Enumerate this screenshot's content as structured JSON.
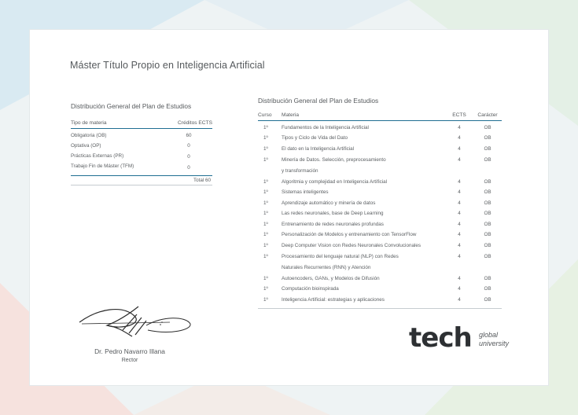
{
  "title": "Máster Título Propio en Inteligencia Artificial",
  "left_table": {
    "heading": "Distribución General del Plan de Estudios",
    "col_type": "Tipo de materia",
    "col_credits": "Créditos ECTS",
    "rows": [
      {
        "type": "Obligatoria (OB)",
        "credits": "60"
      },
      {
        "type": "Optativa (OP)",
        "credits": "0"
      },
      {
        "type": "Prácticas Externas (PR)",
        "credits": "0"
      },
      {
        "type": "Trabajo Fin de Máster (TFM)",
        "credits": "0"
      }
    ],
    "total": "Total 60"
  },
  "right_table": {
    "heading": "Distribución General del Plan de Estudios",
    "col_course": "Curso",
    "col_subject": "Materia",
    "col_ects": "ECTS",
    "col_type": "Carácter",
    "rows": [
      {
        "course": "1º",
        "subject": "Fundamentos de la Inteligencia Artificial",
        "ects": "4",
        "type": "OB"
      },
      {
        "course": "1º",
        "subject": "Tipos y Ciclo de Vida del Dato",
        "ects": "4",
        "type": "OB"
      },
      {
        "course": "1º",
        "subject": "El dato en la Inteligencia Artificial",
        "ects": "4",
        "type": "OB"
      },
      {
        "course": "1º",
        "subject": "Minería de Datos. Selección, preprocesamiento",
        "subject2": "y transformación",
        "ects": "4",
        "type": "OB"
      },
      {
        "course": "1º",
        "subject": "Algoritmia y complejidad en Inteligencia Artificial",
        "ects": "4",
        "type": "OB"
      },
      {
        "course": "1º",
        "subject": "Sistemas inteligentes",
        "ects": "4",
        "type": "OB"
      },
      {
        "course": "1º",
        "subject": "Aprendizaje automático y minería de datos",
        "ects": "4",
        "type": "OB"
      },
      {
        "course": "1º",
        "subject": "Las redes neuronales, base de Deep Learning",
        "ects": "4",
        "type": "OB"
      },
      {
        "course": "1º",
        "subject": "Entrenamiento de redes neuronales profundas",
        "ects": "4",
        "type": "OB"
      },
      {
        "course": "1º",
        "subject": "Personalización de Modelos y entrenamiento con TensorFlow",
        "ects": "4",
        "type": "OB"
      },
      {
        "course": "1º",
        "subject": "Deep Computer Vision con Redes Neuronales Convolucionales",
        "ects": "4",
        "type": "OB"
      },
      {
        "course": "1º",
        "subject": "Procesamiento del lenguaje natural (NLP) con Redes",
        "subject2": "Naturales Recurrentes (RNN) y Atención",
        "ects": "4",
        "type": "OB"
      },
      {
        "course": "1º",
        "subject": "Autoencoders, GANs, y Modelos de Difusión",
        "ects": "4",
        "type": "OB"
      },
      {
        "course": "1º",
        "subject": "Computación bioinspirada",
        "ects": "4",
        "type": "OB"
      },
      {
        "course": "1º",
        "subject": "Inteligencia Artificial: estrategias y aplicaciones",
        "ects": "4",
        "type": "OB"
      }
    ]
  },
  "signature": {
    "name": "Dr. Pedro Navarro Illana",
    "role": "Rector"
  },
  "logo": {
    "main": "tech",
    "line1": "global",
    "line2": "university"
  },
  "colors": {
    "rule": "#1f6e92",
    "text": "#55595c"
  }
}
